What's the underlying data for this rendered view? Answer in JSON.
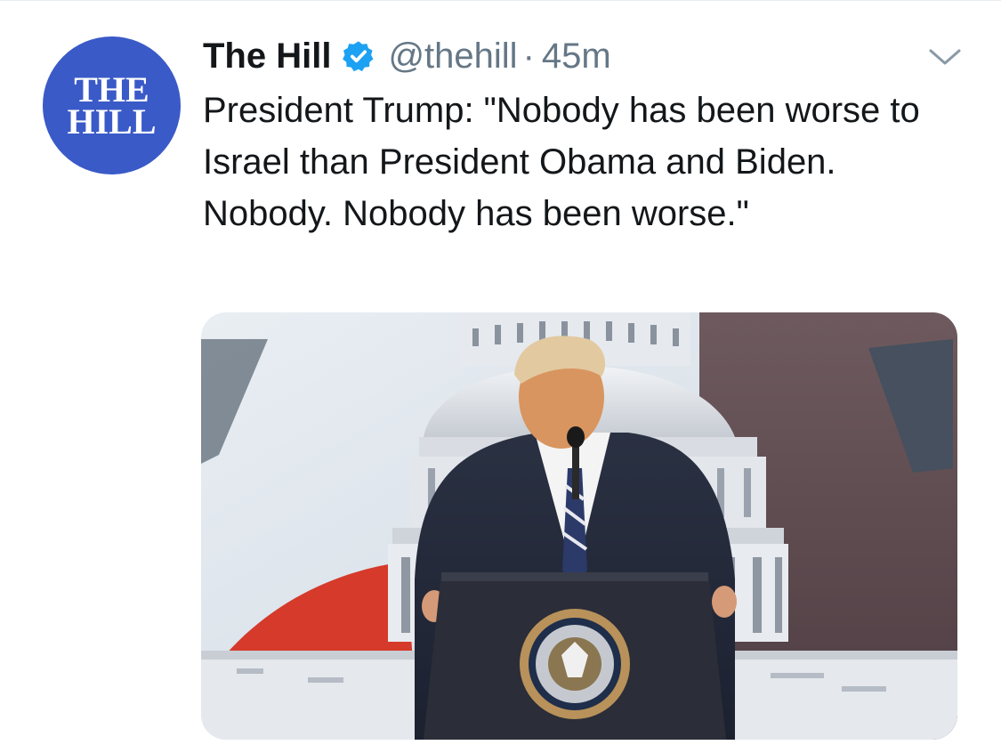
{
  "tweet": {
    "author": {
      "name": "The Hill",
      "handle": "@thehill",
      "verified": true,
      "avatar_text_line1": "THE",
      "avatar_text_line2": "HILL",
      "avatar_color": "#3a5ac8"
    },
    "separator": "·",
    "time": "45m",
    "text": "President Trump: \"Nobody has been worse to Israel than President Obama and Biden. Nobody. Nobody has been worse.\"",
    "menu_icon": "chevron-down-icon",
    "verified_icon": "verified-badge-icon",
    "verified_color": "#1da1f2",
    "media": {
      "type": "video-thumbnail",
      "description_icon": "video-still"
    }
  },
  "colors": {
    "text_primary": "#14171a",
    "text_secondary": "#657786"
  }
}
